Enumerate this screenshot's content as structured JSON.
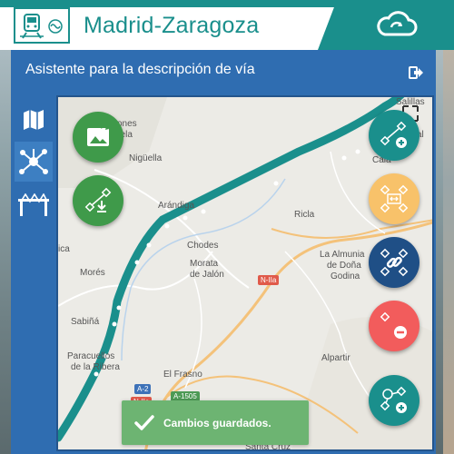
{
  "header": {
    "title": "Madrid-Zaragoza",
    "logo_icon": "train-icon",
    "cloud_icon": "cloud-sync-icon",
    "brand_color": "#1a8f8c"
  },
  "panel": {
    "title": "Asistente para la descripción de vía",
    "exit_icon": "exit-icon",
    "color": "#2f6db1"
  },
  "rail": {
    "items": [
      {
        "icon": "map-icon",
        "active": false
      },
      {
        "icon": "network-icon",
        "active": true
      },
      {
        "icon": "bridge-icon",
        "active": false
      }
    ]
  },
  "map": {
    "places": {
      "sesones": "sones",
      "suela": "suela",
      "niguella": "Nigüella",
      "arandiga": "Arándiga",
      "chodes": "Chodes",
      "morata": "Morata",
      "dejalon": "de Jalón",
      "ricla": "Ricla",
      "moros": "Morés",
      "ica": "ica",
      "almunia": "La Almunia",
      "donagodina": "de Doña",
      "godina": "Godina",
      "sabinan": "Sabiñá",
      "paracuellos": "Paracuellos",
      "delarivera": "de la Ribera",
      "elfrasno": "El Frasno",
      "alpartir": "Alpartir",
      "santacruz": "Santa Cruz",
      "cala": "Cala",
      "salillas": "Salillas",
      "dejal": "de Jal"
    },
    "roads": {
      "n2a_top": "N-IIa",
      "a2": "A-2",
      "n2a_bottom": "N-IIa",
      "a1505": "A-1505"
    }
  },
  "fabs": {
    "upload_image": {
      "icon": "image-upload-icon",
      "color": "#3f9a4a"
    },
    "download_track": {
      "icon": "track-download-icon",
      "color": "#3f9a4a"
    },
    "add_segment": {
      "icon": "segment-add-icon",
      "color": "#1a8f8c"
    },
    "edit_segment": {
      "icon": "segment-edit-icon",
      "color": "#f8c26a"
    },
    "link_segment": {
      "icon": "chain-link-icon",
      "color": "#1f4f86"
    },
    "remove_point": {
      "icon": "remove-icon",
      "color": "#f25c5c"
    },
    "add_node": {
      "icon": "node-add-icon",
      "color": "#1a8f8c"
    }
  },
  "toast": {
    "message": "Cambios guardados.",
    "color": "#6db472"
  }
}
